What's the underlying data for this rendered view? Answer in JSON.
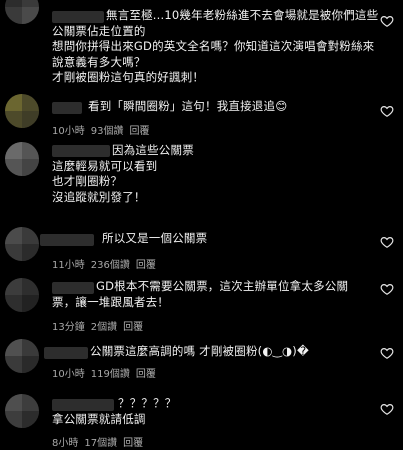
{
  "comments": [
    {
      "lines": [
        "無言至極...10幾年老粉絲進不去會場就是被你們這些",
        "公關票佔走位置的",
        "想問你拼得出來GD的英文全名嗎？你知道這次演唱會對粉絲來",
        "說意義有多大嗎？",
        "才剛被圈粉這句真的好諷刺！"
      ],
      "time": "",
      "likes": "",
      "reply": ""
    },
    {
      "lines": [
        "看到「瞬間圈粉」這句！我直接退追😊"
      ],
      "time": "10小時",
      "likes": "93個讚",
      "reply": "回覆"
    },
    {
      "lines": [
        "因為這些公關票",
        "這麼輕易就可以看到",
        "也才剛圈粉？",
        "沒追蹤就別發了！"
      ],
      "time": "",
      "likes": "",
      "reply": ""
    },
    {
      "lines": [
        "所以又是一個公關票"
      ],
      "time": "11小時",
      "likes": "236個讚",
      "reply": "回覆"
    },
    {
      "lines": [
        "GD根本不需要公關票，這次主辦單位拿太多公關",
        "票，讓一堆跟風者去！"
      ],
      "time": "13分鐘",
      "likes": "2個讚",
      "reply": "回覆"
    },
    {
      "lines": [
        "公關票這麼高調的嗎 才剛被圈粉(◐‿◑)�"
      ],
      "time": "10小時",
      "likes": "119個讚",
      "reply": "回覆"
    },
    {
      "lines": [
        "？？？？？",
        "拿公關票就請低調"
      ],
      "time": "8小時",
      "likes": "17個讚",
      "reply": "回覆"
    }
  ],
  "icons": {
    "like": "heart-outline-icon"
  }
}
